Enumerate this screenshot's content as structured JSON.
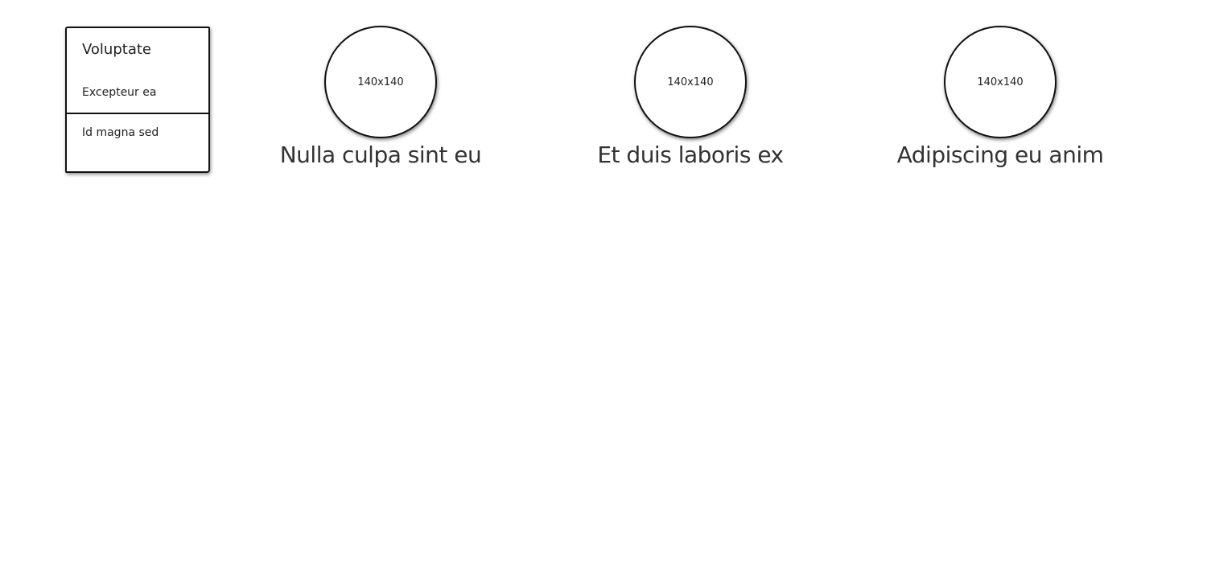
{
  "sidebar": {
    "title": "Voluptate",
    "items": [
      {
        "label": "Excepteur ea"
      },
      {
        "label": "Id magna sed"
      }
    ]
  },
  "cards": [
    {
      "image_label": "140x140",
      "title": "Nulla culpa sint eu"
    },
    {
      "image_label": "140x140",
      "title": "Et duis laboris ex"
    },
    {
      "image_label": "140x140",
      "title": "Adipiscing eu anim"
    }
  ]
}
